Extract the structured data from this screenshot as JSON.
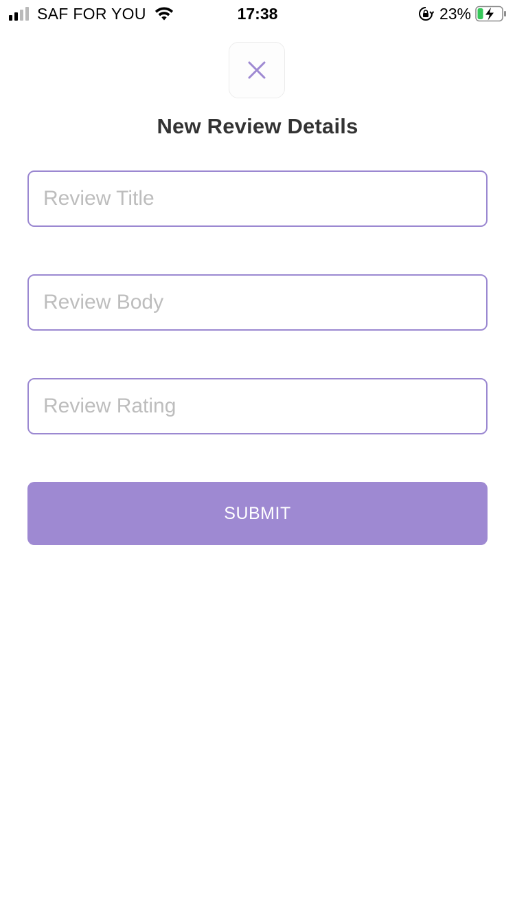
{
  "status_bar": {
    "carrier": "SAF FOR YOU",
    "time": "17:38",
    "battery_percent": "23%",
    "icons": [
      "signal-icon",
      "wifi-icon",
      "rotation-lock-icon",
      "battery-charging-icon"
    ],
    "colors": {
      "battery_fill": "#35c759"
    }
  },
  "close_button": {
    "icon": "close-icon",
    "color": "#9e89d2"
  },
  "header": {
    "title": "New Review Details"
  },
  "form": {
    "review_title": {
      "value": "",
      "placeholder": "Review Title"
    },
    "review_body": {
      "value": "",
      "placeholder": "Review Body"
    },
    "review_rating": {
      "value": "",
      "placeholder": "Review Rating"
    },
    "submit_label": "SUBMIT"
  },
  "theme": {
    "accent": "#9e89d2",
    "input_border": "#9b88d1",
    "placeholder": "#bdbdbd",
    "title_text": "#333333"
  }
}
